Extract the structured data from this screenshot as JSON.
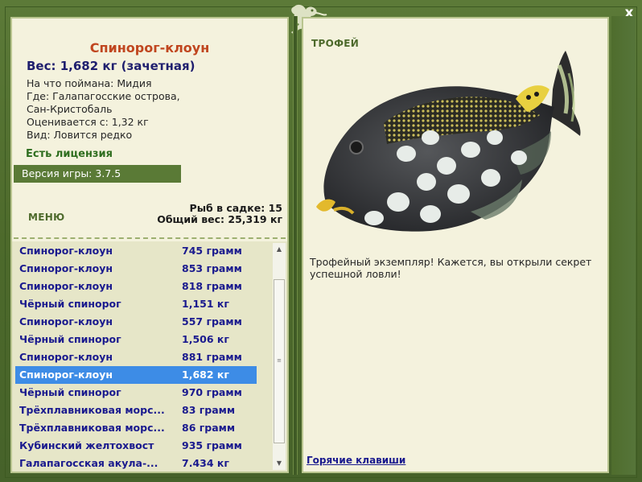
{
  "window": {
    "close_label": "x"
  },
  "catch": {
    "title": "Спинорог-клоун",
    "weight": "Вес: 1,682 кг (зачетная)",
    "bait": "На что поймана: Мидия",
    "location_line1": "Где: Галапагосские острова,",
    "location_line2": "Сан-Кристобаль",
    "rated_from": "Оценивается с: 1,32 кг",
    "species_note": "Вид: Ловится редко",
    "license": "Есть лицензия",
    "game_version": "Версия игры: 3.7.5"
  },
  "menu_label": "МЕНЮ",
  "stats": {
    "fish_in_keepnet": "Рыб в садке: 15",
    "total_weight": "Общий вес: 25,319 кг"
  },
  "fish_list": [
    {
      "name": "Спинорог-клоун",
      "weight": "745 грамм"
    },
    {
      "name": "Спинорог-клоун",
      "weight": "853 грамм"
    },
    {
      "name": "Спинорог-клоун",
      "weight": "818 грамм"
    },
    {
      "name": "Чёрный спинорог",
      "weight": "1,151 кг"
    },
    {
      "name": "Спинорог-клоун",
      "weight": "557 грамм"
    },
    {
      "name": "Чёрный спинорог",
      "weight": "1,506 кг"
    },
    {
      "name": "Спинорог-клоун",
      "weight": "881 грамм"
    },
    {
      "name": "Спинорог-клоун",
      "weight": "1,682 кг",
      "selected": true
    },
    {
      "name": "Чёрный спинорог",
      "weight": "970 грамм"
    },
    {
      "name": "Трёхплавниковая морс...",
      "weight": "83 грамм"
    },
    {
      "name": "Трёхплавниковая морс...",
      "weight": "86 грамм"
    },
    {
      "name": "Кубинский желтохвост",
      "weight": "935 грамм"
    },
    {
      "name": "Галапагосская акула-...",
      "weight": "7.434 кг"
    }
  ],
  "trophy": {
    "label": "ТРОФЕЙ",
    "text_line1": "Трофейный экземпляр! Кажется, вы открыли секрет",
    "text_line2": "успешной ловли!",
    "hotkeys_label": "Горячие клавиши"
  },
  "colors": {
    "frame": "#4f6a2f",
    "panel": "#f4f2dd",
    "title_orange": "#c0461f",
    "list_text": "#1a1a8e",
    "selected_row": "#3d8ce6",
    "license_green": "#2f6e1f"
  }
}
